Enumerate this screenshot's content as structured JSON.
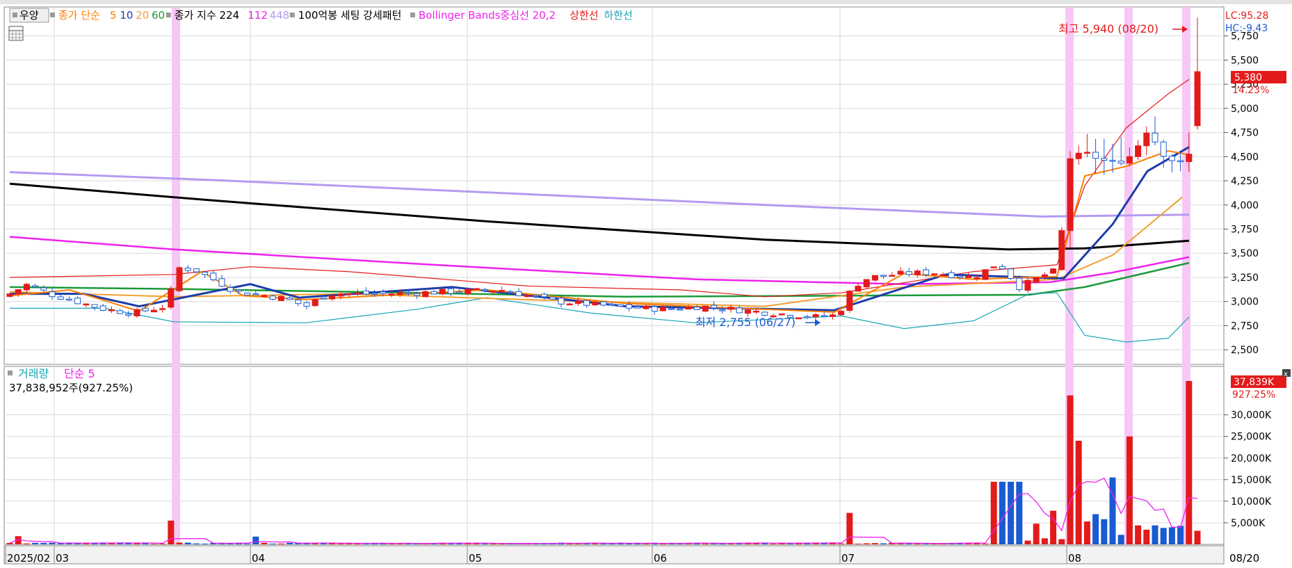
{
  "header": {
    "stock_button": "우양",
    "legend": [
      {
        "text": "종가 단순",
        "color": "#ff7f00"
      },
      {
        "text": "5",
        "color": "#ff7f00"
      },
      {
        "text": "10",
        "color": "#1e3caa"
      },
      {
        "text": "20",
        "color": "#f0a030"
      },
      {
        "text": "60",
        "color": "#1a9a3a"
      },
      {
        "text": "종가 지수 224",
        "color": "#000000"
      },
      {
        "text": "112",
        "color": "#ee22ee"
      },
      {
        "text": "448",
        "color": "#b49bf0"
      },
      {
        "text": "100억봉 세팅 강세패턴",
        "color": "#000000"
      },
      {
        "text": "Bollinger Bands중심선 20,2",
        "color": "#ee22ee"
      },
      {
        "text": "상한선",
        "color": "#e31a1a"
      },
      {
        "text": "하한선",
        "color": "#17a5b5"
      }
    ]
  },
  "corner": {
    "lc": "LC:95.28",
    "hc": "HC:-9.43"
  },
  "price_panel": {
    "current_price": "5,380",
    "current_change": "14.23%",
    "high_label": "최고 5,940 (08/20)",
    "low_label": "최저 2,755 (06/27)",
    "y_ticks": [
      "5,750",
      "5,500",
      "5,250",
      "5,000",
      "4,750",
      "4,500",
      "4,250",
      "4,000",
      "3,750",
      "3,500",
      "3,250",
      "3,000",
      "2,750",
      "2,500"
    ]
  },
  "volume_panel": {
    "title": "거래량",
    "title_ma": "단순 5",
    "summary": "37,838,952주(927.25%)",
    "current_volume": "37,839K",
    "current_change": "927.25%",
    "y_ticks": [
      "30,000K",
      "25,000K",
      "20,000K",
      "15,000K",
      "10,000K",
      "5,000K"
    ]
  },
  "x_axis": {
    "labels": [
      "2025/02",
      "03",
      "04",
      "05",
      "06",
      "07",
      "08"
    ],
    "end_label": "08/20"
  },
  "colors": {
    "up": "#e31a1a",
    "down": "#1a5ad2",
    "highlight": "#f7c8f5",
    "grid": "#d8d8d8"
  },
  "chart_data": {
    "type": "candlestick",
    "x": [
      "2025-02-20",
      "2025-02-28",
      "2025-03-31",
      "2025-04-30",
      "2025-05-30",
      "2025-06-27",
      "2025-07-18",
      "2025-07-31",
      "2025-08-04",
      "2025-08-08",
      "2025-08-12",
      "2025-08-20"
    ],
    "close": [
      3050,
      2900,
      2950,
      3100,
      2950,
      2840,
      3250,
      3250,
      4450,
      4450,
      4550,
      5380
    ],
    "high_point": {
      "value": 5940,
      "date": "08/20"
    },
    "low_point": {
      "value": 2755,
      "date": "06/27"
    },
    "series": [
      {
        "name": "224",
        "values": [
          4220,
          4100,
          3980,
          3850,
          3720,
          3600,
          3560,
          3520,
          3530,
          3560,
          3590,
          3630
        ]
      },
      {
        "name": "112",
        "values": [
          3650,
          3570,
          3480,
          3380,
          3250,
          3100,
          3060,
          3050,
          3150,
          3250,
          3330,
          3450
        ]
      },
      {
        "name": "448",
        "values": [
          4330,
          4280,
          4220,
          4150,
          4050,
          3950,
          3920,
          3880,
          3890,
          3900,
          3905,
          3900
        ]
      },
      {
        "name": "60",
        "values": [
          3150,
          3130,
          3100,
          3070,
          3040,
          3020,
          3040,
          3070,
          3100,
          3170,
          3250,
          3380
        ]
      }
    ],
    "volume_change": "927.25%",
    "y_range_price": [
      2350,
      6050
    ],
    "y_range_volume_k": [
      0,
      38000
    ]
  }
}
